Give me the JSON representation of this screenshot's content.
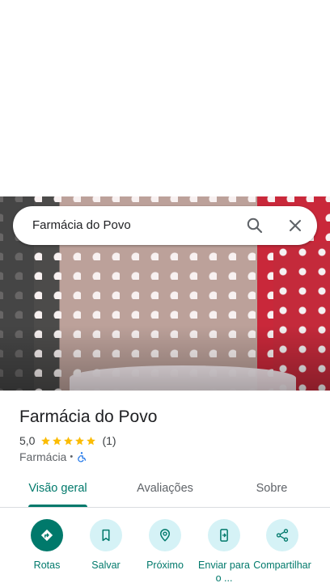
{
  "search": {
    "query": "Farmácia do Povo"
  },
  "place": {
    "name": "Farmácia do Povo",
    "rating": "5,0",
    "stars": 5,
    "review_count": "(1)",
    "category": "Farmácia",
    "separator": "•"
  },
  "tabs": [
    {
      "label": "Visão geral"
    },
    {
      "label": "Avaliações"
    },
    {
      "label": "Sobre"
    }
  ],
  "actions": [
    {
      "label": "Rotas"
    },
    {
      "label": "Salvar"
    },
    {
      "label": "Próximo"
    },
    {
      "label": "Enviar para o ..."
    },
    {
      "label": "Compartilhar"
    }
  ],
  "colors": {
    "accent": "#00796b",
    "action_bg": "#d5f2f6",
    "star": "#fbbc04"
  },
  "icons": [
    "search-icon",
    "close-icon",
    "star-icon",
    "accessibility-icon",
    "directions-icon",
    "bookmark-icon",
    "nearby-icon",
    "send-to-phone-icon",
    "share-icon"
  ]
}
